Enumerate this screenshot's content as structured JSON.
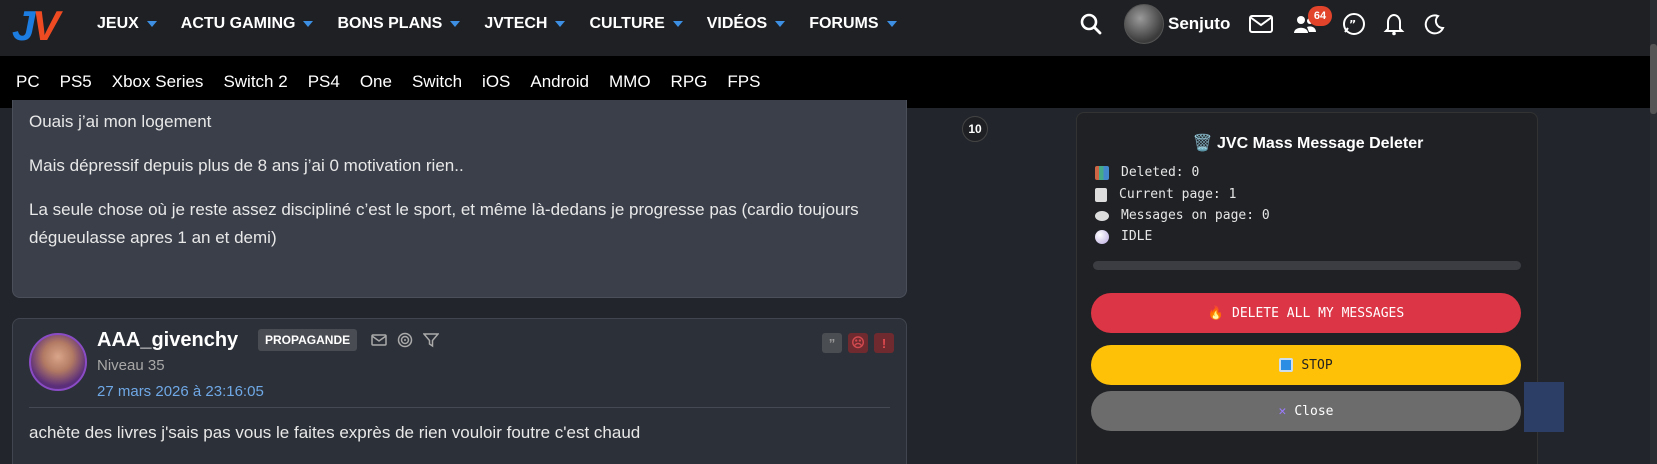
{
  "logo": {
    "j": "J",
    "v": "V"
  },
  "nav": {
    "items": [
      "JEUX",
      "ACTU GAMING",
      "BONS PLANS",
      "JVTECH",
      "CULTURE",
      "VIDÉOS",
      "FORUMS"
    ],
    "username": "Senjuto",
    "friends_badge": "64"
  },
  "platforms": [
    "PC",
    "PS5",
    "Xbox Series",
    "Switch 2",
    "PS4",
    "One",
    "Switch",
    "iOS",
    "Android",
    "MMO",
    "RPG",
    "FPS"
  ],
  "post1": {
    "line1": "Ouais j’ai mon logement",
    "line2": "Mais dépressif depuis plus de 8 ans j’ai 0 motivation rien..",
    "line3a": "La seule chose où je reste assez discipliné c’est le sport, et même là-dedans je progresse pas (cardio toujours",
    "line3b": "dégueulasse apres 1 an et demi)"
  },
  "page_badge": "10",
  "post2": {
    "author": "AAA_givenchy",
    "tag": "PROPAGANDE",
    "niveau": "Niveau 35",
    "date": "27 mars 2026 à 23:16:05",
    "text": "achète des livres j'sais pas vous le faites exprès de rien vouloir foutre c'est chaud"
  },
  "panel": {
    "title": "🗑️ JVC Mass Message Deleter",
    "deleted": "Deleted: 0",
    "current_page": "Current page: 1",
    "messages_on_page": "Messages on page: 0",
    "status": "IDLE",
    "progress": 0,
    "delete_label": "DELETE ALL MY MESSAGES",
    "stop_label": "STOP",
    "close_label": "Close",
    "colors": {
      "delete": "#dc3545",
      "stop": "#ffc107",
      "close": "#6c6c6c"
    }
  }
}
